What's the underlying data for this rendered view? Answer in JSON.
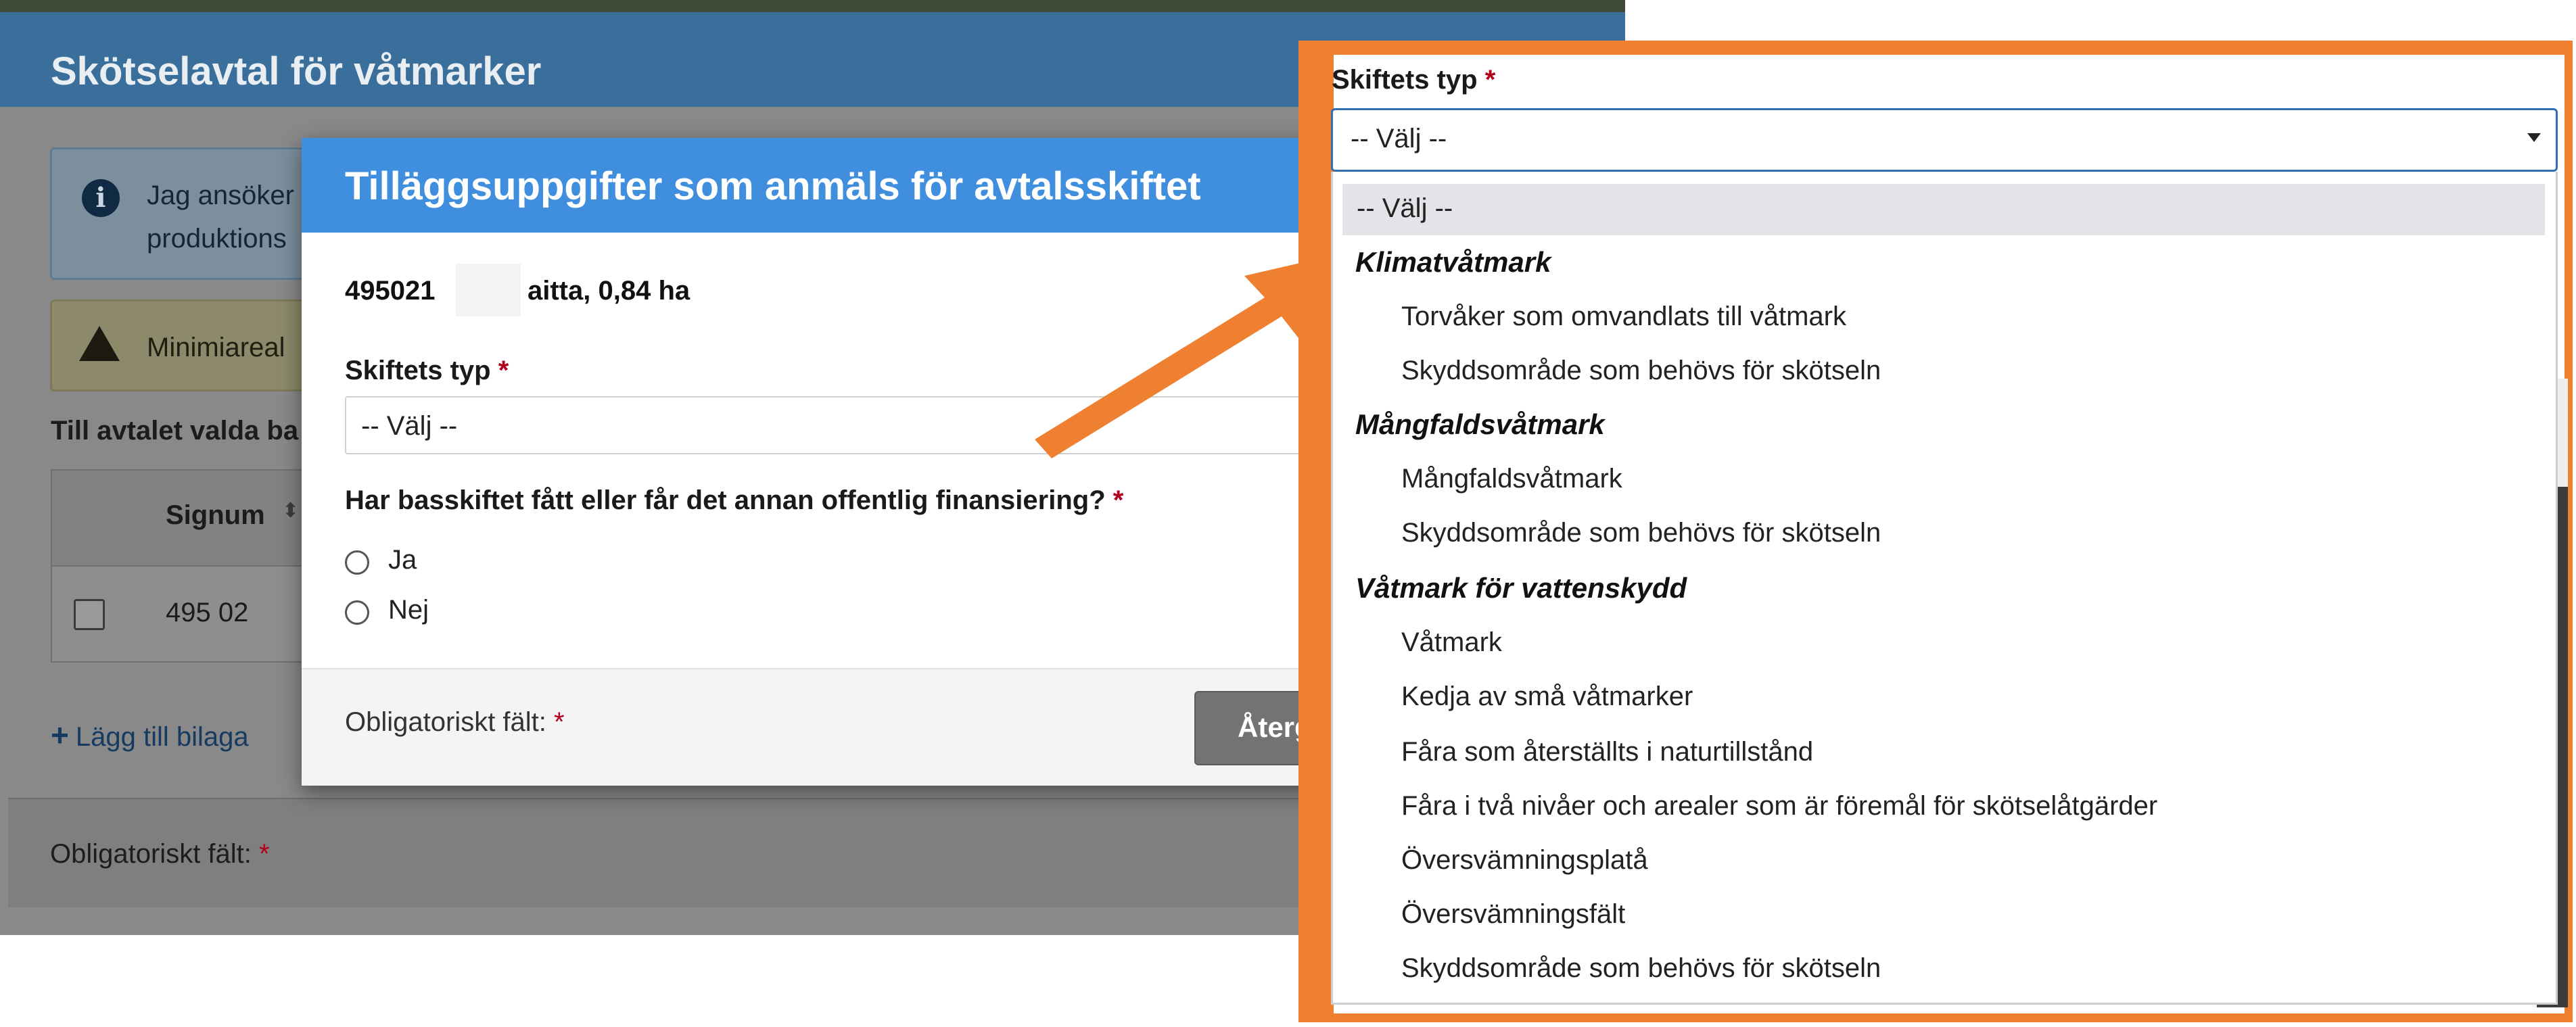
{
  "background_window": {
    "title": "Skötselavtal för våtmarker",
    "info_text_line1": "Jag ansöker",
    "info_text_line2": "produktions",
    "warning_text": "Minimiareal",
    "table_title": "Till avtalet valda ba",
    "table": {
      "columns": [
        "Signum"
      ],
      "rows": [
        [
          "495 02"
        ]
      ]
    },
    "add_attachment_label": "Lägg till bilaga",
    "footer_label": "Obligatoriskt fält:",
    "required_marker": "*"
  },
  "modal": {
    "title": "Tilläggsuppgifter som anmäls för avtalsskiftet",
    "parcel_id": "495021",
    "parcel_name": "aitta, 0,84 ha",
    "skiftets_typ_label": "Skiftets typ",
    "skiftets_typ_value": "-- Välj --",
    "funding_question": "Har basskiftet fått eller får det annan offentlig finansiering?",
    "radio_options": [
      "Ja",
      "Nej"
    ],
    "footer_label": "Obligatoriskt fält:",
    "return_button_label": "Återg",
    "required_marker": "*"
  },
  "dropdown": {
    "label": "Skiftets typ",
    "required_marker": "*",
    "selected_value": "-- Välj --",
    "placeholder_option": "-- Välj --",
    "groups": [
      {
        "label": "Klimatvåtmark",
        "options": [
          "Torvåker som omvandlats till våtmark",
          "Skyddsområde som behövs för skötseln"
        ]
      },
      {
        "label": "Mångfaldsvåtmark",
        "options": [
          "Mångfaldsvåtmark",
          "Skyddsområde som behövs för skötseln"
        ]
      },
      {
        "label": "Våtmark för vattenskydd",
        "options": [
          "Våtmark",
          "Kedja av små våtmarker",
          "Fåra som återställts i naturtillstånd",
          "Fåra i två nivåer och arealer som är föremål för skötselåtgärder",
          "Översvämningsplatå",
          "Översvämningsfält",
          "Skyddsområde som behövs för skötseln"
        ]
      }
    ]
  },
  "colors": {
    "modal_header": "#3f8fde",
    "callout_border": "#ef7f31",
    "arrow": "#ef7f31",
    "required": "#b1001c",
    "select_focus_border": "#2f6fb2"
  },
  "icons": {
    "info": "info-icon",
    "warning": "warning-icon",
    "sort": "sort-icon",
    "add": "plus-icon",
    "caret": "caret-down-icon",
    "arrow": "callout-arrow-icon"
  }
}
